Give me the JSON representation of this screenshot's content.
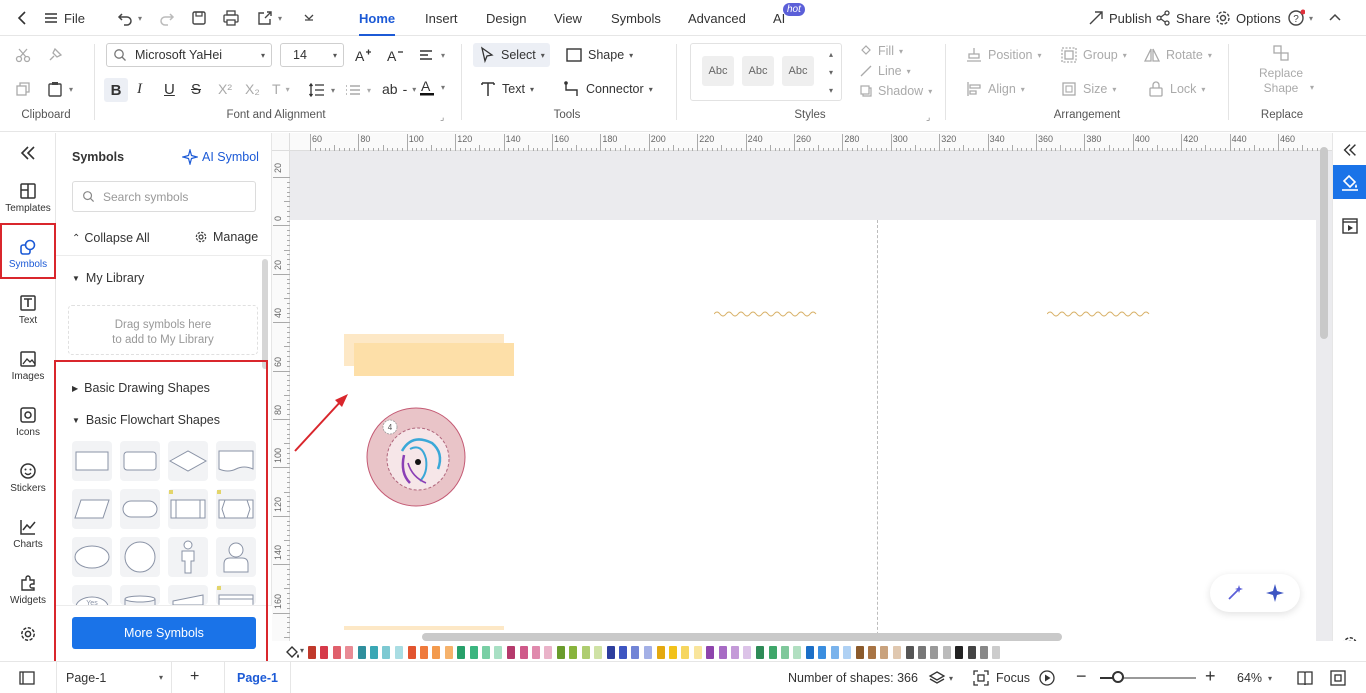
{
  "topbar": {
    "file_label": "File",
    "tabs": [
      "Home",
      "Insert",
      "Design",
      "View",
      "Symbols",
      "Advanced",
      "AI"
    ],
    "ai_badge": "hot",
    "publish_label": "Publish",
    "share_label": "Share",
    "options_label": "Options"
  },
  "ribbon": {
    "font_name": "Microsoft YaHei",
    "font_size": "14",
    "select_label": "Select",
    "shape_label": "Shape",
    "text_label": "Text",
    "connector_label": "Connector",
    "style_sample": "Abc",
    "fill_label": "Fill",
    "line_label": "Line",
    "shadow_label": "Shadow",
    "position_label": "Position",
    "group_label": "Group",
    "rotate_label": "Rotate",
    "align_label": "Align",
    "size_label": "Size",
    "lock_label": "Lock",
    "replace_shape_line1": "Replace",
    "replace_shape_line2": "Shape",
    "groups": {
      "clipboard": "Clipboard",
      "font": "Font and Alignment",
      "tools": "Tools",
      "styles": "Styles",
      "arrangement": "Arrangement",
      "replace": "Replace"
    }
  },
  "rail": {
    "items": [
      "Templates",
      "Symbols",
      "Text",
      "Images",
      "Icons",
      "Stickers",
      "Charts",
      "Widgets"
    ]
  },
  "panel": {
    "title": "Symbols",
    "ai_symbol": "AI Symbol",
    "search_placeholder": "Search symbols",
    "collapse_all": "Collapse All",
    "manage": "Manage",
    "my_library": "My Library",
    "drop_hint_1": "Drag symbols here",
    "drop_hint_2": "to add to My Library",
    "basic_drawing": "Basic Drawing Shapes",
    "basic_flowchart": "Basic Flowchart Shapes",
    "more_symbols": "More Symbols"
  },
  "canvas": {
    "hruler_ticks": [
      "60",
      "80",
      "100",
      "120",
      "140",
      "160",
      "180",
      "200",
      "220",
      "240",
      "260",
      "280",
      "300",
      "320",
      "340",
      "360",
      "380",
      "400",
      "420",
      "440",
      "460"
    ],
    "vruler_ticks": [
      "20",
      "0",
      "20",
      "40",
      "60",
      "80",
      "100",
      "120",
      "140",
      "160"
    ],
    "badge_number": "4"
  },
  "palette": {
    "colors": [
      "#c0392b",
      "#d63a4a",
      "#e0606c",
      "#e98b95",
      "#2f8f9d",
      "#3aa8b5",
      "#7dc9d2",
      "#a9dde3",
      "#e2542f",
      "#ef7a3c",
      "#f39a4d",
      "#f6b26b",
      "#27a06a",
      "#3bb57f",
      "#79cfa5",
      "#a8e0c4",
      "#b53a6c",
      "#cf5a8a",
      "#e08aad",
      "#eab3c9",
      "#6a9c2c",
      "#88b43c",
      "#aecd70",
      "#cfe2a5",
      "#2d3e9e",
      "#3d55c2",
      "#7184d6",
      "#a3b0e6",
      "#e4a910",
      "#f2c21a",
      "#f6d65f",
      "#f9e59c",
      "#8e44ad",
      "#a76bc4",
      "#c49ad8",
      "#dcc3e8",
      "#2e8b57",
      "#3fa76a",
      "#7fc89b",
      "#b1dfc1",
      "#1c6fc7",
      "#3a8ee0",
      "#7ab3ec",
      "#afd1f4",
      "#8b5a2b",
      "#a87444",
      "#c9a27d",
      "#e0c8b0",
      "#555555",
      "#777777",
      "#999999",
      "#bbbbbb",
      "#222222",
      "#444444",
      "#888888",
      "#cccccc"
    ]
  },
  "status": {
    "page_select": "Page-1",
    "page_tab": "Page-1",
    "shapes_count": "Number of shapes: 366",
    "focus": "Focus",
    "zoom": "64%"
  }
}
